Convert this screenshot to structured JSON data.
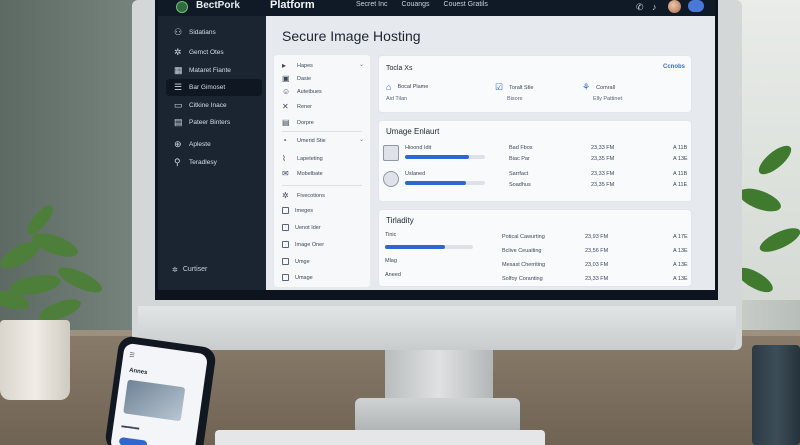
{
  "app": {
    "brand": "BectPork",
    "platform": "Platform",
    "top_nav": [
      "Secret Inc",
      "Couangs",
      "Couest Gratils"
    ]
  },
  "sidebar": {
    "items": [
      {
        "label": "Sidatians",
        "icon": "user-icon"
      },
      {
        "label": "Gemct Otes",
        "icon": "gear-icon"
      },
      {
        "label": "Mataret Fiante",
        "icon": "grid-icon"
      },
      {
        "label": "Bar Gimoset",
        "icon": "list-icon"
      },
      {
        "label": "Citkine Inace",
        "icon": "monitor-icon"
      },
      {
        "label": "Pateer Binters",
        "icon": "document-icon"
      },
      {
        "label": "Apleste",
        "icon": "plus-icon"
      },
      {
        "label": "Teradlesy",
        "icon": "person-icon"
      }
    ],
    "footer": "Curtiser"
  },
  "main": {
    "title": "Secure Image Hosting",
    "subnav": [
      {
        "label": "Hapes",
        "icon": "folder-icon",
        "chevron": true
      },
      {
        "label": "Dasie",
        "icon": "image-icon"
      },
      {
        "label": "Autetbues",
        "icon": "person-icon"
      },
      {
        "label": "Rener",
        "icon": "tool-icon"
      },
      {
        "label": "Dorpre",
        "icon": "document-icon"
      },
      {
        "label": "Umerid Stie",
        "icon": "clock-icon",
        "chevron": true
      },
      {
        "label": "Lapeteting",
        "icon": "chart-icon"
      },
      {
        "label": "Mobelbate",
        "icon": "mail-icon"
      },
      {
        "label": "Fivecotions",
        "icon": "settings-icon"
      },
      {
        "label": "Imeges",
        "icon": "checkbox"
      },
      {
        "label": "Uenot Ider",
        "icon": "checkbox"
      },
      {
        "label": "Image Oner",
        "icon": "checkbox"
      },
      {
        "label": "Umge",
        "icon": "checkbox"
      },
      {
        "label": "Umage",
        "icon": "checkbox"
      }
    ]
  },
  "tools_card": {
    "title": "Tocla Xs",
    "link": "Ccnobs",
    "options": [
      {
        "label": "Bocal Plame",
        "sub": "Aid  Tilan",
        "icon": "upload-icon"
      },
      {
        "label": "Toralt Stle",
        "sub": "Bisore",
        "icon": "check-icon"
      },
      {
        "label": "Comrall",
        "sub": "Elly Pattinet",
        "icon": "share-icon"
      }
    ]
  },
  "image_card": {
    "title": "Umage Enlaurt",
    "rows": [
      {
        "name": "Hioond Idit",
        "progress": 0.8,
        "meta": [
          "Bad Fbos",
          "Biac Par"
        ],
        "size": [
          "23,33 FM",
          "23,35 FM"
        ],
        "unit": [
          "A 11B",
          "A 13E"
        ]
      },
      {
        "name": "Uslaned",
        "progress": 0.76,
        "meta": [
          "Sarrfact",
          "Soadhus"
        ],
        "size": [
          "23,33 FM",
          "23,35 FM"
        ],
        "unit": [
          "A 11B",
          "A 11E"
        ]
      }
    ]
  },
  "activity_card": {
    "title": "Tirladity",
    "progress_label": "Tinic",
    "progress": 0.68,
    "labels": [
      "Mlag",
      "Aneed"
    ],
    "rows": [
      {
        "label": "Potical Cawurting",
        "size": "23,93 FM",
        "unit": "A 17E"
      },
      {
        "label": "Bclive Ceuaiting",
        "size": "23,56 FM",
        "unit": "A 13E"
      },
      {
        "label": "Mesast Cherriting",
        "size": "23,03 FM",
        "unit": "A 13E"
      },
      {
        "label": "Solfoy Coranting",
        "size": "23,33 FM",
        "unit": "A 13E"
      }
    ]
  },
  "phone": {
    "title": "Annes"
  },
  "colors": {
    "accent": "#2f66d0",
    "sidebar": "#1b2532",
    "content_bg": "#e6e9ee"
  }
}
